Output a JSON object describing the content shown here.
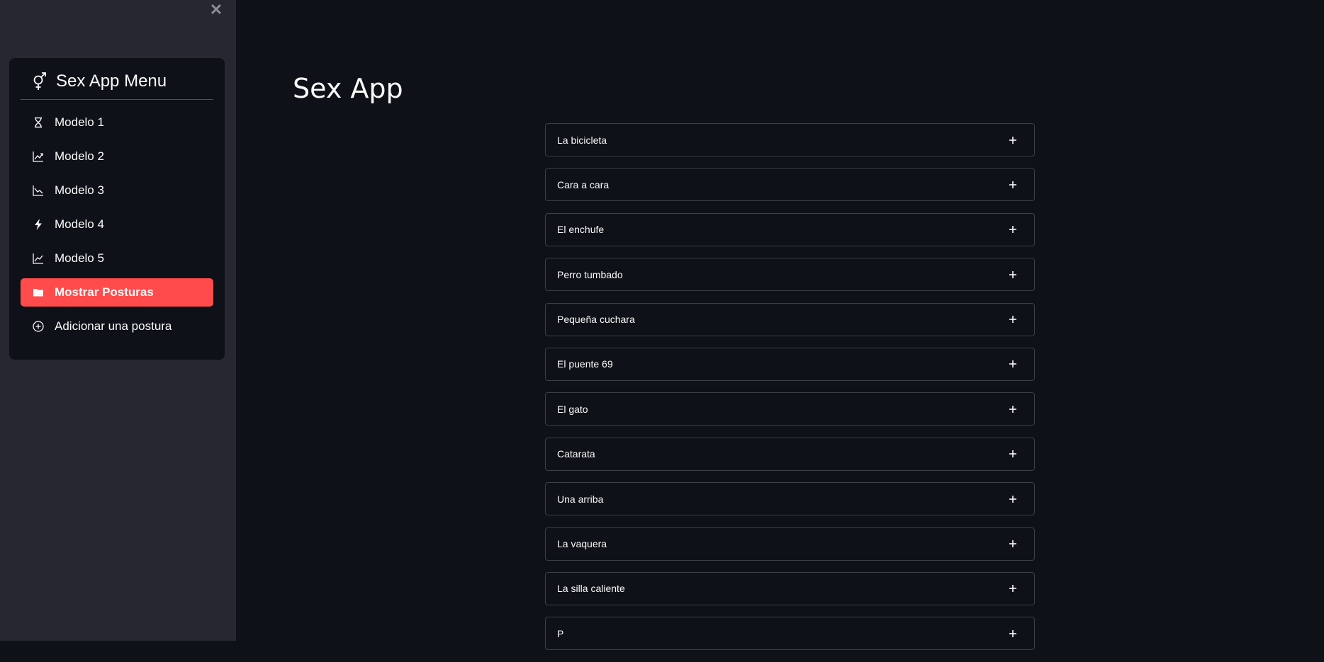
{
  "sidebar": {
    "close_icon": "close-icon",
    "menu": {
      "icon": "gender-icon",
      "title": "Sex App Menu",
      "items": [
        {
          "label": "Modelo 1",
          "icon": "hourglass-icon",
          "active": false
        },
        {
          "label": "Modelo 2",
          "icon": "graph-up-arrow-icon",
          "active": false
        },
        {
          "label": "Modelo 3",
          "icon": "graph-down-icon",
          "active": false
        },
        {
          "label": "Modelo 4",
          "icon": "lightning-icon",
          "active": false
        },
        {
          "label": "Modelo 5",
          "icon": "graph-up-icon",
          "active": false
        },
        {
          "label": "Mostrar Posturas",
          "icon": "folder-icon",
          "active": true
        },
        {
          "label": "Adicionar una postura",
          "icon": "plus-circle-icon",
          "active": false
        }
      ]
    }
  },
  "main": {
    "title": "Sex App",
    "expanders": [
      {
        "label": "La bicicleta"
      },
      {
        "label": "Cara a cara"
      },
      {
        "label": "El enchufe"
      },
      {
        "label": "Perro tumbado"
      },
      {
        "label": "Pequeña cuchara"
      },
      {
        "label": "El puente 69"
      },
      {
        "label": "El gato"
      },
      {
        "label": "Catarata"
      },
      {
        "label": "Una arriba"
      },
      {
        "label": "La vaquera"
      },
      {
        "label": "La silla caliente"
      },
      {
        "label": "P"
      }
    ]
  },
  "colors": {
    "background": "#0e1117",
    "sidebar": "#262730",
    "accent": "#ff4b4b",
    "text": "#fafafa",
    "border": "#3d3f46"
  }
}
